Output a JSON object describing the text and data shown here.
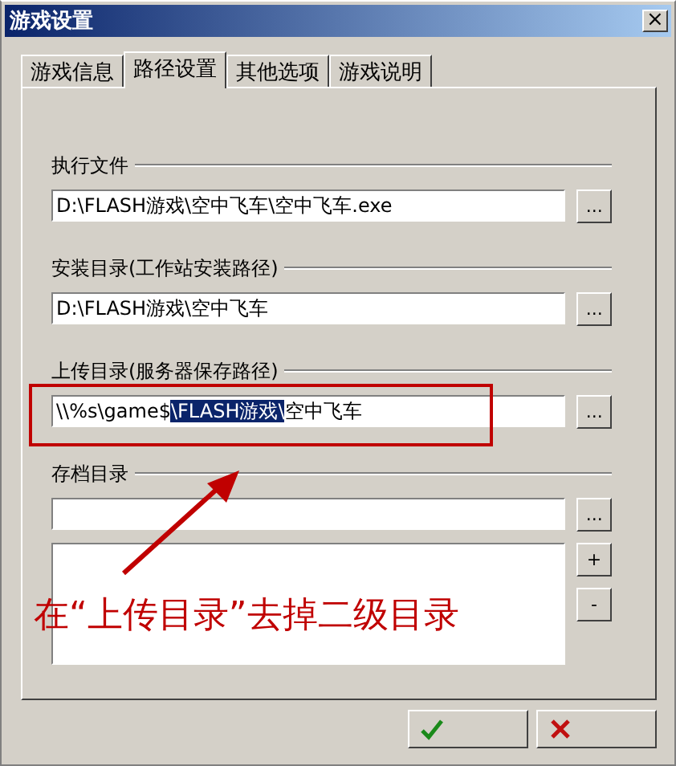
{
  "window": {
    "title": "游戏设置",
    "close": "×"
  },
  "tabs": [
    {
      "label": "游戏信息",
      "selected": false
    },
    {
      "label": "路径设置",
      "selected": true
    },
    {
      "label": "其他选项",
      "selected": false
    },
    {
      "label": "游戏说明",
      "selected": false
    }
  ],
  "groups": [
    {
      "label": "执行文件",
      "value": "D:\\FLASH游戏\\空中飞车\\空中飞车.exe",
      "browse": "..."
    },
    {
      "label": "安装目录(工作站安装路径)",
      "value": "D:\\FLASH游戏\\空中飞车",
      "browse": "..."
    },
    {
      "label": "上传目录(服务器保存路径)",
      "value_before": "\\\\%s\\game$",
      "value_selected": "\\FLASH游戏\\",
      "value_after": "空中飞车",
      "browse": "..."
    },
    {
      "label": "存档目录",
      "browse": "..."
    }
  ],
  "list_buttons": [
    "+",
    "-"
  ],
  "annotation": {
    "text": "在“上传目录”去掉二级目录"
  },
  "footer_buttons": [
    {
      "kind": "ok"
    },
    {
      "kind": "cancel"
    }
  ]
}
